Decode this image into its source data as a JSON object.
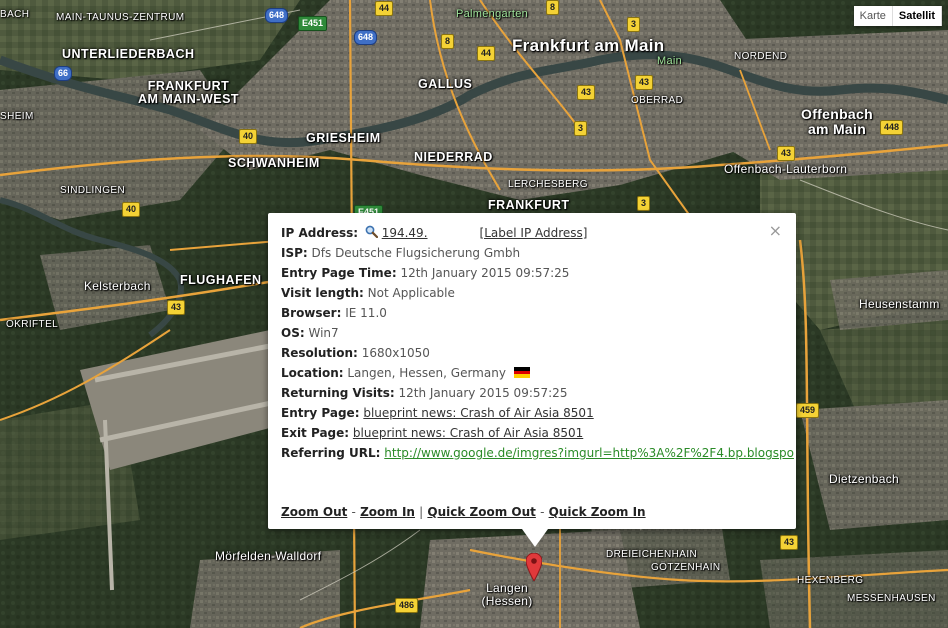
{
  "map_type": {
    "map": "Karte",
    "satellite": "Satellit",
    "active": "satellite"
  },
  "places": {
    "frankfurt": "Frankfurt am Main",
    "offenbach": "Offenbach am Main",
    "offenbach_lauterborn": "Offenbach-Lauterborn",
    "unterliederbach": "UNTERLIEDERBACH",
    "frankfurt_west": "FRANKFURT AM MAIN-WEST",
    "griesheim": "GRIESHEIM",
    "schwanheim": "SCHWANHEIM",
    "niederrad": "NIEDERRAD",
    "gallus": "GALLUS",
    "sindlingen": "SINDLINGEN",
    "flughafen": "FLUGHAFEN",
    "kelsterbach": "Kelsterbach",
    "okriftel": "OKRIFTEL",
    "moerfelden": "Mörfelden-Walldorf",
    "langen": "Langen (Hessen)",
    "heusenstamm": "Heusenstamm",
    "dietzenbach": "Dietzenbach",
    "dreieichenhain": "DREIEICHENHAIN",
    "goetzenhain": "GÖTZENHAIN",
    "hexenberg": "HEXENBERG",
    "messenhausen": "MESSENHAUSEN",
    "lerchesberg": "LERCHESBERG",
    "frankfurt_south": "FRANKFURT",
    "oberrad": "OBERRAD",
    "nordend": "NORDEND",
    "main_river": "Main",
    "palmengarten": "Palmengarten",
    "main_taunus": "MAIN-TAUNUS-ZENTRUM",
    "bach": "BACH",
    "sheim": "SHEIM"
  },
  "shields": {
    "a648_1": "648",
    "a648_2": "648",
    "a66": "66",
    "e451": "E451",
    "e451_2": "E451",
    "a44_1": "44",
    "a44_2": "44",
    "a8_1": "8",
    "a8_2": "8",
    "a3_1": "3",
    "a3_2": "3",
    "a3_3": "3",
    "a43_1": "43",
    "a43_2": "43",
    "a43_3": "43",
    "a43_4": "43",
    "a43_5": "43",
    "a40_1": "40",
    "a40_2": "40",
    "a448": "448",
    "a459": "459",
    "a486": "486"
  },
  "info": {
    "ip_label": "IP Address:",
    "ip_value": "194.49.",
    "ip_link": "[Label IP Address]",
    "isp_label": "ISP:",
    "isp": "Dfs Deutsche Flugsicherung Gmbh",
    "entry_time_label": "Entry Page Time:",
    "entry_time": "12th January 2015 09:57:25",
    "visit_length_label": "Visit length:",
    "visit_length": "Not Applicable",
    "browser_label": "Browser:",
    "browser": "IE 11.0",
    "os_label": "OS:",
    "os": "Win7",
    "resolution_label": "Resolution:",
    "resolution": "1680x1050",
    "location_label": "Location:",
    "location": "Langen, Hessen, Germany",
    "returning_label": "Returning Visits:",
    "returning": "12th January 2015 09:57:25",
    "entry_page_label": "Entry Page:",
    "entry_page": "blueprint news: Crash of Air Asia 8501",
    "exit_page_label": "Exit Page:",
    "exit_page": "blueprint news: Crash of Air Asia 8501",
    "referring_label": "Referring URL:",
    "referring_url": "http://www.google.de/imgres?imgurl=http%3A%2F%2F4.bp.blogspo",
    "close": "×",
    "zoom_out": "Zoom Out",
    "zoom_in": "Zoom In",
    "quick_zoom_out": "Quick Zoom Out",
    "quick_zoom_in": "Quick Zoom In",
    "sep_dash": "-",
    "sep_bar": "|"
  },
  "colors": {
    "forest": "#2c3a26",
    "urban": "#6d6a60",
    "road": "#e8a33b",
    "river": "#3c4d4a",
    "pin": "#e0393b",
    "link_green": "#2a8b27"
  },
  "icons": {
    "search": "magnifier-icon",
    "flag": "germany-flag-icon",
    "pin": "map-marker-icon"
  }
}
